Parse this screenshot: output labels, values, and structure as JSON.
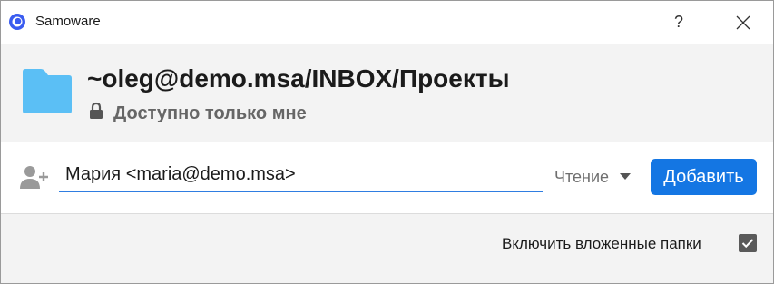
{
  "window": {
    "title": "Samoware",
    "help_label": "?"
  },
  "header": {
    "folder_path": "~oleg@demo.msa/INBOX/Проекты",
    "access_text": "Доступно только мне"
  },
  "invite": {
    "user_value": "Мария <maria@demo.msa>",
    "role_selected": "Чтение",
    "add_button_label": "Добавить"
  },
  "footer": {
    "include_subfolders_label": "Включить вложенные папки",
    "include_subfolders_checked": true
  },
  "colors": {
    "accent": "#1476e3",
    "folder": "#5bbff5",
    "header_bg": "#f3f3f3"
  },
  "icons": [
    "app-logo-icon",
    "close-icon",
    "folder-icon",
    "lock-icon",
    "add-user-icon",
    "chevron-down-icon",
    "checkmark-icon"
  ]
}
